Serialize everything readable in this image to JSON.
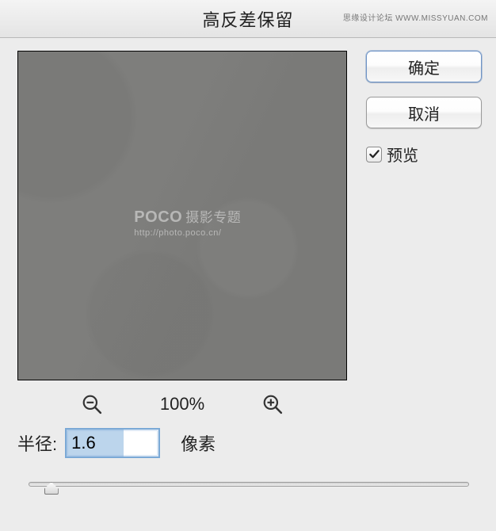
{
  "window": {
    "title": "高反差保留",
    "top_watermark": "思缘设计论坛  WWW.MISSYUAN.COM"
  },
  "preview": {
    "watermark_line1_a": "POCO",
    "watermark_line1_b": "摄影专题",
    "watermark_line2": "http://photo.poco.cn/"
  },
  "zoom": {
    "level": "100%"
  },
  "radius": {
    "label": "半径:",
    "value": "1.6",
    "unit": "像素",
    "slider_percent": 5
  },
  "buttons": {
    "ok": "确定",
    "cancel": "取消"
  },
  "preview_checkbox": {
    "label": "预览",
    "checked": true
  }
}
